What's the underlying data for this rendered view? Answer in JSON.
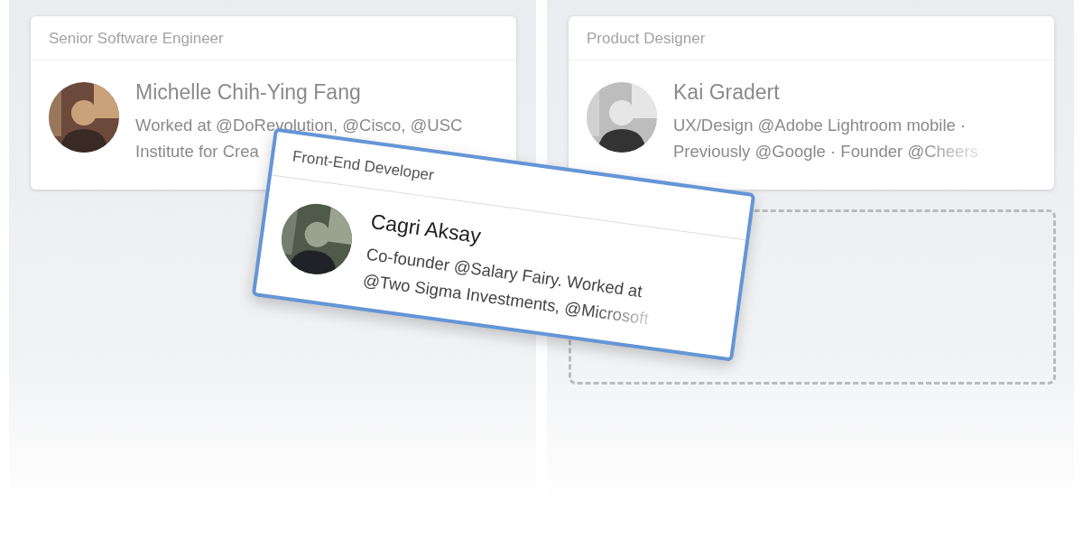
{
  "columns": [
    {
      "cards": [
        {
          "role": "Senior Software Engineer",
          "name": "Michelle Chih-Ying Fang",
          "bio_lines": [
            "Worked at @DoRevolution, @Cisco, @USC",
            "Institute for Crea"
          ]
        }
      ]
    },
    {
      "cards": [
        {
          "role": "Product Designer",
          "name": "Kai Gradert",
          "bio_lines": [
            "UX/Design @Adobe Lightroom mobile ·",
            "Previously @Google · Founder @Cheers"
          ]
        }
      ],
      "drop_placeholder": true
    }
  ],
  "dragged_card": {
    "role": "Front-End Developer",
    "name": "Cagri Aksay",
    "bio_lines": [
      "Co-founder @Salary Fairy. Worked at",
      "@Two Sigma Investments, @Microsoft"
    ]
  }
}
